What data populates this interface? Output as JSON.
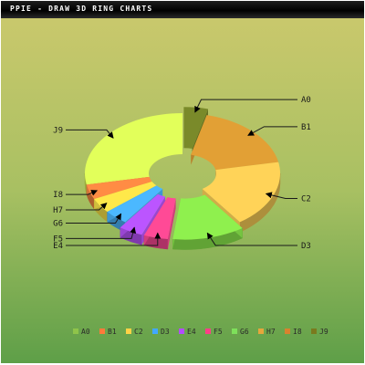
{
  "window": {
    "title": "PPIE - DRAW 3D RING CHARTS"
  },
  "chart_data": {
    "type": "pie",
    "variant": "3d-ring",
    "title": "PPIE - DRAW 3D RING CHARTS",
    "legend_position": "bottom",
    "labels": [
      "A0",
      "B1",
      "C2",
      "D3",
      "E4",
      "F5",
      "G6",
      "H7",
      "I8",
      "J9"
    ],
    "values": [
      4,
      18,
      18,
      12,
      4,
      4,
      4,
      4,
      4,
      28
    ],
    "exploded": [
      "A0",
      "D3",
      "E4",
      "F5"
    ],
    "colors": [
      "#7a8a2a",
      "#e2a035",
      "#ffd358",
      "#8ff04e",
      "#ff4a96",
      "#bb55ff",
      "#4bb8ff",
      "#ffe84a",
      "#ff8c44",
      "#e2ff5a"
    ],
    "legend_colors": [
      "#8fc44a",
      "#ff7a3a",
      "#ffd246",
      "#42a8ff",
      "#b24cff",
      "#ff3d88",
      "#7ee05a",
      "#e6a63c",
      "#d8822e",
      "#7a7a1e"
    ]
  }
}
